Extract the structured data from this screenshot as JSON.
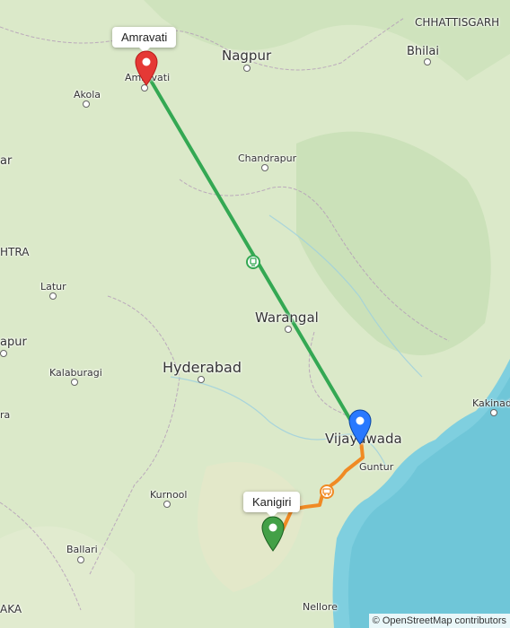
{
  "map": {
    "labels": {
      "chhattisgarh": "CHHATTISGARH",
      "bhilai": "Bhilai",
      "nagpur": "Nagpur",
      "amravati": "Amravati",
      "akola": "Akola",
      "chandrapur": "Chandrapur",
      "ar": "ar",
      "htra": "HTRA",
      "latur": "Latur",
      "apur": "apur",
      "warangal": "Warangal",
      "hyderabad": "Hyderabad",
      "kalaburagi": "Kalaburagi",
      "ra": "ra",
      "kakinada": "Kakinada",
      "vijayawada": "Vijayawada",
      "guntur": "Guntur",
      "kurnool": "Kurnool",
      "ballari": "Ballari",
      "nellore": "Nellore",
      "aka": "AKA"
    },
    "callouts": {
      "start": "Amravati",
      "end": "Kanigiri"
    },
    "route": {
      "green_color": "#34a853",
      "orange_color": "#f08a24",
      "mode_icons": [
        "train-icon",
        "bus-icon"
      ]
    },
    "markers": {
      "start_color": "#e53935",
      "mid_color": "#2979ff",
      "end_color": "#43a047"
    },
    "attribution": "© OpenStreetMap contributors"
  }
}
